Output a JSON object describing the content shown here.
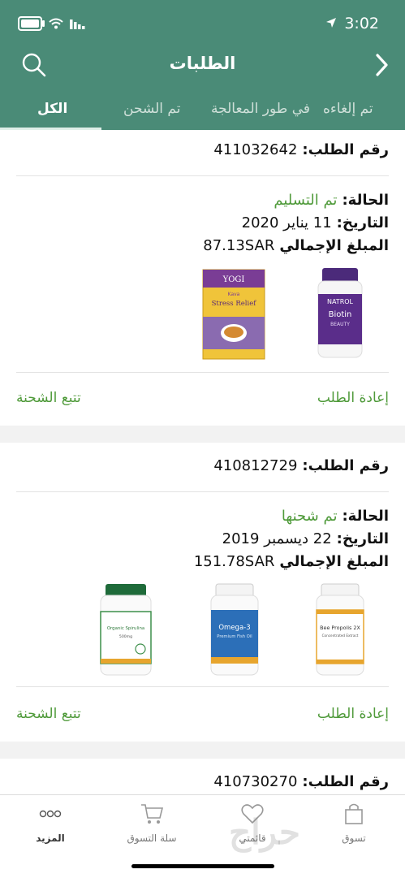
{
  "status_bar": {
    "time": "3:02"
  },
  "header": {
    "title": "الطلبات"
  },
  "tabs": [
    {
      "label": "الكل",
      "active": true
    },
    {
      "label": "تم الشحن",
      "active": false
    },
    {
      "label": "في طور المعالجة",
      "active": false
    },
    {
      "label": "تم إلغاءه",
      "active": false
    }
  ],
  "labels": {
    "order_number": "رقم الطلب:",
    "status": "الحالة:",
    "date": "التاريخ:",
    "total": "المبلغ الإجمالي",
    "reorder": "إعادة الطلب",
    "track": "تتبع الشحنة"
  },
  "orders": [
    {
      "number": "411032642",
      "status": "تم التسليم",
      "date": "11 يناير 2020",
      "total": "87.13SAR",
      "products": [
        {
          "name": "Natrol Biotin",
          "brand": "NATROL",
          "title": "Biotin",
          "sub": "BEAUTY",
          "cap_color": "#4b2a7a",
          "label_color": "#5a2d8a"
        },
        {
          "name": "Yogi Kava Stress Relief",
          "brand": "YOGI",
          "title": "Stress Relief",
          "sub": "Kava",
          "cap_color": "#7a3d95",
          "label_color": "#f0c43a"
        }
      ]
    },
    {
      "number": "410812729",
      "status": "تم شحنها",
      "date": "22 ديسمبر 2019",
      "total": "151.78SAR",
      "products": [
        {
          "name": "Bee Propolis 2X",
          "brand": "California GOLD Nutrition",
          "title": "Bee Propolis 2X",
          "sub": "Concentrated Extract",
          "cap_color": "#f2f2f2",
          "label_color": "#e7a52e"
        },
        {
          "name": "Omega-3 Premium Fish Oil",
          "brand": "California GOLD Nutrition",
          "title": "Omega-3",
          "sub": "Premium Fish Oil",
          "cap_color": "#f2f2f2",
          "label_color": "#2c6fb8"
        },
        {
          "name": "Organic Spirulina",
          "brand": "California GOLD Nutrition",
          "title": "Organic Spirulina",
          "sub": "500mg",
          "cap_color": "#1f6b3a",
          "label_color": "#3d8f4a"
        }
      ]
    },
    {
      "number": "410730270"
    }
  ],
  "bottom_nav": [
    {
      "label": "تسوق",
      "icon": "shop-bag-icon",
      "active": false
    },
    {
      "label": "قائمتي",
      "icon": "heart-icon",
      "active": false
    },
    {
      "label": "سلة التسوق",
      "icon": "cart-icon",
      "active": false
    },
    {
      "label": "المزيد",
      "icon": "more-icon",
      "active": true
    }
  ],
  "watermark": "حراج",
  "colors": {
    "header": "#4a8b77",
    "accent_green": "#4f9a3a"
  }
}
